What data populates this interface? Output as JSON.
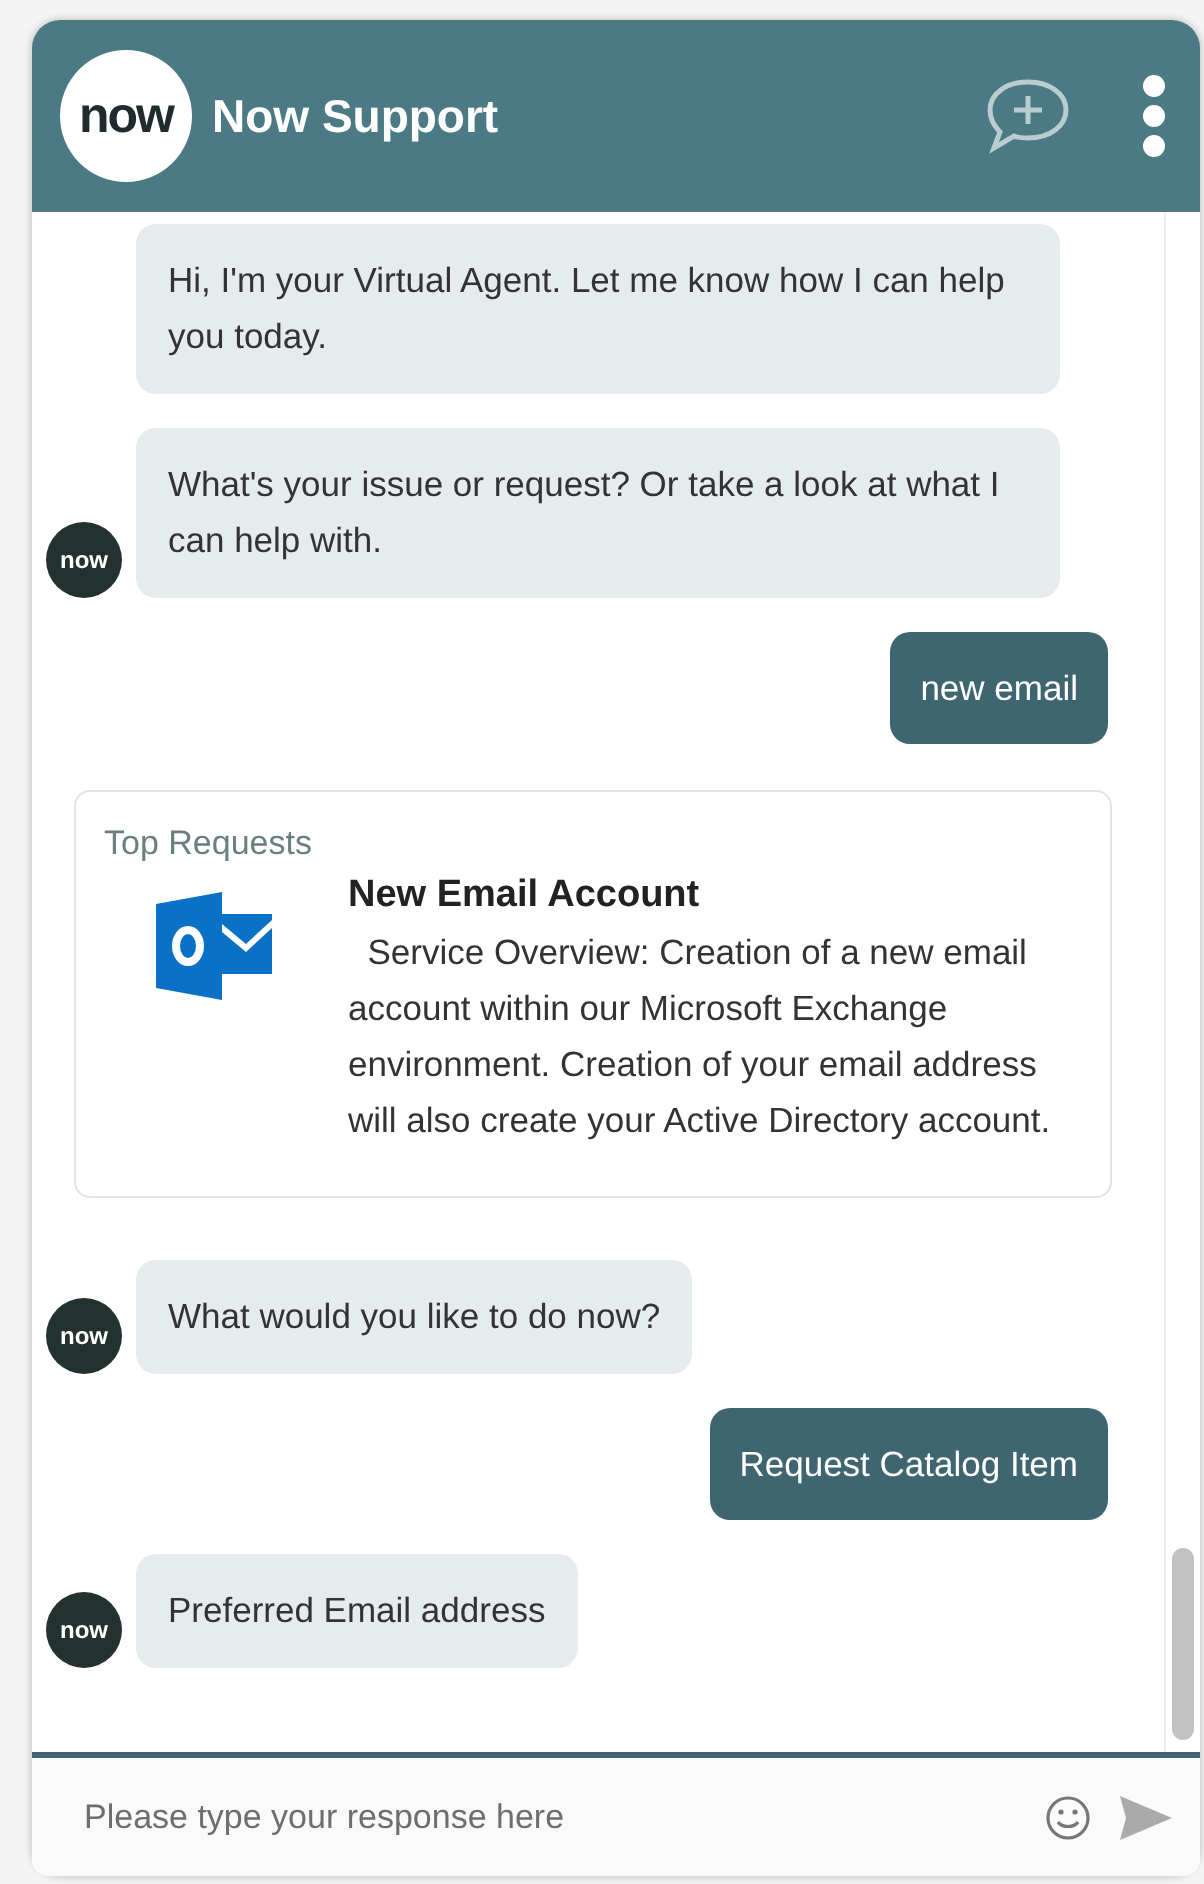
{
  "header": {
    "logo": "now",
    "title": "Now Support"
  },
  "messages": [
    {
      "kind": "agent",
      "text": "Hi, I'm your Virtual Agent. Let me know how I can help you today."
    },
    {
      "kind": "agent",
      "text": "What's your issue or request? Or take a look at what I can help with.",
      "avatar": "now"
    },
    {
      "kind": "user",
      "text": "new email"
    },
    {
      "kind": "card",
      "heading": "Top Requests",
      "title": "New Email Account",
      "description": "  Service Overview: Creation of a new email account within our Microsoft Exchange environment. Creation of your email address will also create your Active Directory account."
    },
    {
      "kind": "agent",
      "text": "What would you like to do now?",
      "avatar": "now"
    },
    {
      "kind": "user",
      "text": "Request Catalog Item"
    },
    {
      "kind": "agent",
      "text": "Preferred Email address",
      "avatar": "now"
    }
  ],
  "composer": {
    "placeholder": "Please type your response here"
  }
}
